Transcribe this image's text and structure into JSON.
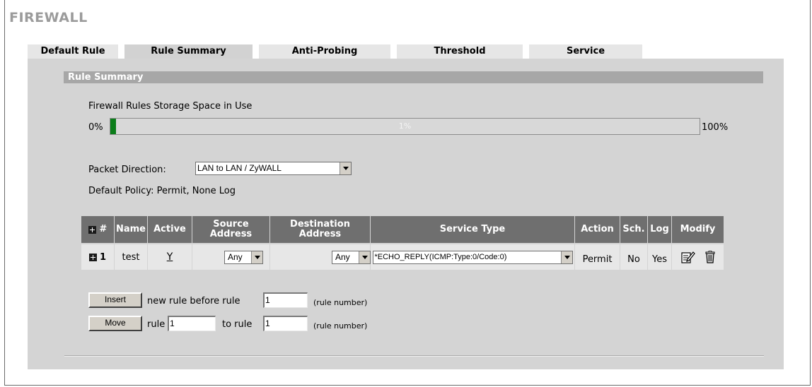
{
  "page": {
    "title": "FIREWALL"
  },
  "tabs": [
    {
      "label": "Default Rule",
      "active": false
    },
    {
      "label": "Rule Summary",
      "active": true
    },
    {
      "label": "Anti-Probing",
      "active": false
    },
    {
      "label": "Threshold",
      "active": false
    },
    {
      "label": "Service",
      "active": false
    }
  ],
  "section": {
    "title": "Rule Summary"
  },
  "storage": {
    "label": "Firewall Rules Storage Space in Use",
    "min_label": "0%",
    "max_label": "100%",
    "value_label": "1%",
    "value_percent": 1
  },
  "packet_direction": {
    "label": "Packet Direction:",
    "selected": "LAN to LAN / ZyWALL"
  },
  "default_policy": "Default Policy: Permit, None Log",
  "table": {
    "headers": {
      "index": "#",
      "name": "Name",
      "active": "Active",
      "source": "Source Address",
      "destination": "Destination Address",
      "service": "Service Type",
      "action": "Action",
      "schedule": "Sch.",
      "log": "Log",
      "modify": "Modify"
    },
    "rows": [
      {
        "index": "1",
        "name": "test",
        "active": "Y",
        "source": "Any",
        "destination": "Any",
        "service": "*ECHO_REPLY(ICMP:Type:0/Code:0)",
        "action": "Permit",
        "schedule": "No",
        "log": "Yes"
      }
    ]
  },
  "insert": {
    "button": "Insert",
    "text": "new rule before rule",
    "value": "1",
    "hint": "(rule number)"
  },
  "move": {
    "button": "Move",
    "rule_label": "rule",
    "rule_value": "1",
    "to_label": "to rule",
    "to_value": "1",
    "hint": "(rule number)"
  },
  "colors": {
    "header_bg": "#6f6f6f",
    "panel_bg": "#d4d4d4",
    "section_bar": "#a7a7a7",
    "progress_fill": "#0b7d1a",
    "title": "#9b9b9b"
  }
}
